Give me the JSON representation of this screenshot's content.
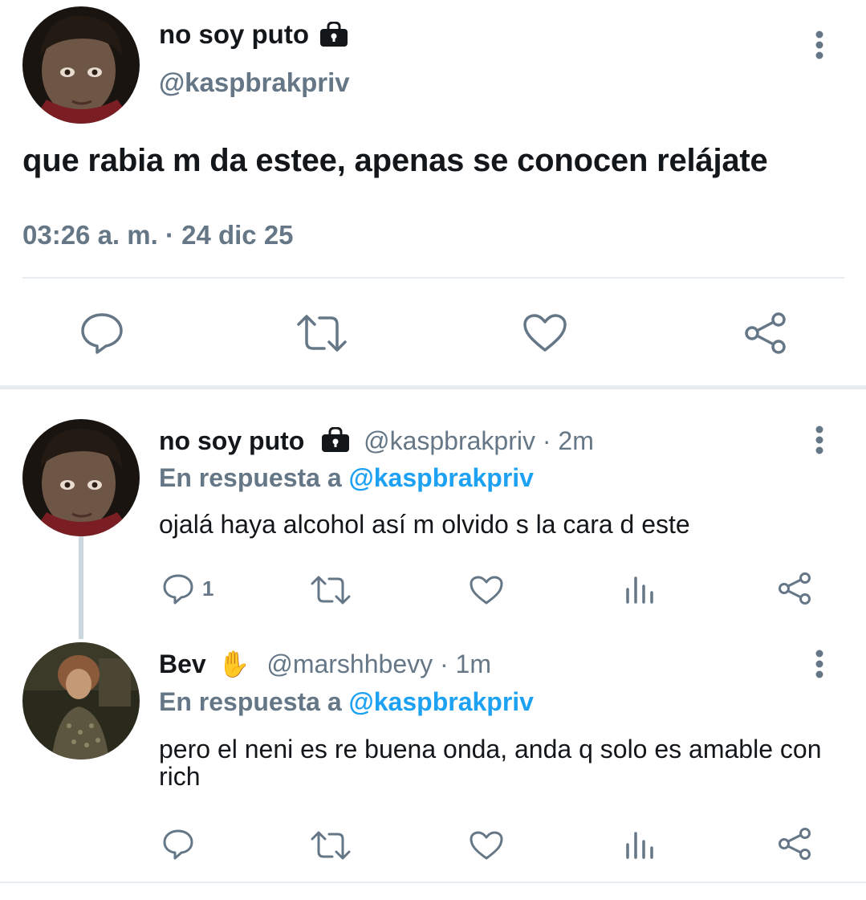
{
  "main_tweet": {
    "display_name": "no soy puto",
    "handle": "@kaspbrakpriv",
    "text": "que rabia m da estee, apenas se conocen relájate",
    "timestamp": "03:26 a. m. · 24 dic 25",
    "icons": [
      "lock-icon",
      "more-vert-icon",
      "reply-icon",
      "retweet-icon",
      "like-icon",
      "share-icon"
    ]
  },
  "replies": [
    {
      "display_name": "no soy puto",
      "handle": "@kaspbrakpriv",
      "time_ago": "· 2m",
      "replying_prefix": "En respuesta a",
      "replying_to": "@kaspbrakpriv",
      "text": "ojalá haya alcohol así m olvido s la cara d este",
      "reply_count": "1"
    },
    {
      "display_name": "Bev",
      "badge_emoji": "✋",
      "handle": "@marshhbevy",
      "time_ago": "· 1m",
      "replying_prefix": "En respuesta a",
      "replying_to": "@kaspbrakpriv",
      "text": "pero el neni es re buena onda, anda q solo es amable con rich"
    }
  ],
  "colors": {
    "primary_text": "#14171a",
    "secondary_text": "#657786",
    "link": "#1da1f2",
    "divider": "#e6ecf0",
    "thread_line": "#ccd6dd"
  }
}
